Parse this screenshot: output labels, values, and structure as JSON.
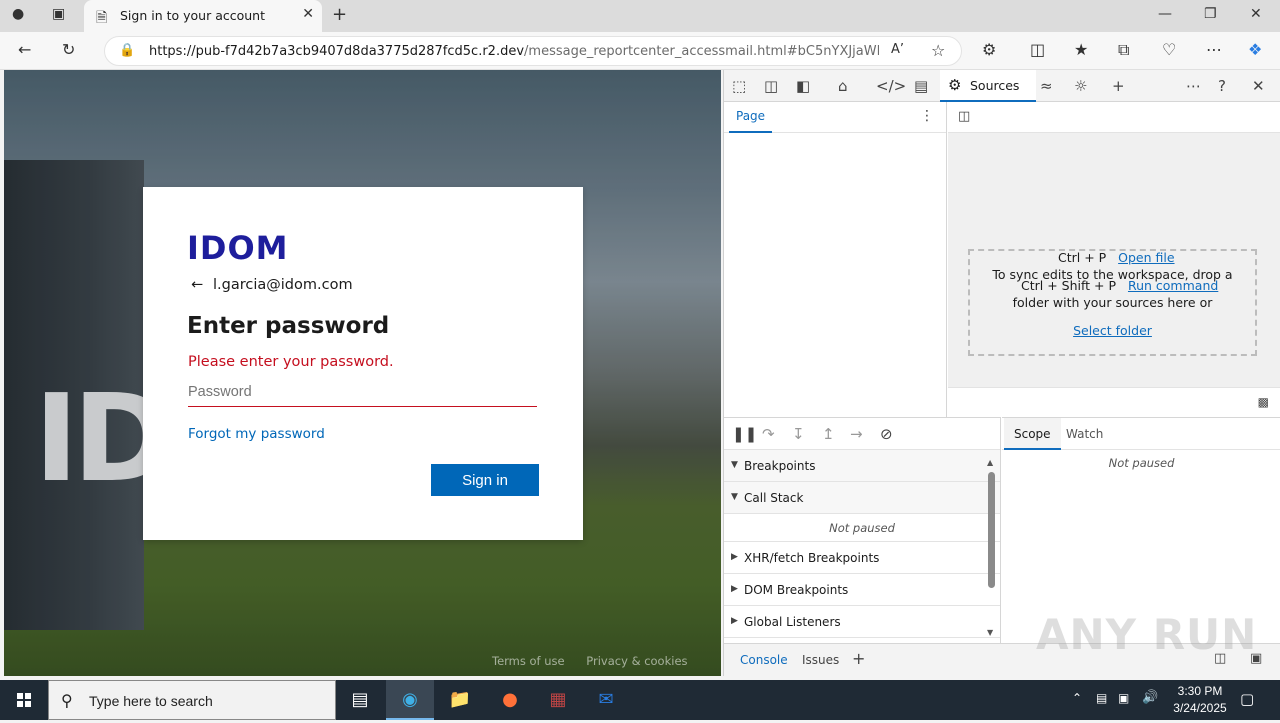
{
  "browser": {
    "tab_title": "Sign in to your account",
    "url_host": "https://pub-f7d42b7a3cb9407d8da3775d287fcd5c.r2.dev",
    "url_path": "/message_reportcenter_accessmail.html#bC5nYXJjaWFAaW..."
  },
  "login": {
    "logo": "IDOM",
    "account": "l.garcia@idom.com",
    "heading": "Enter password",
    "error": "Please enter your password.",
    "password_placeholder": "Password",
    "forgot": "Forgot my password",
    "signin": "Sign in",
    "footer": [
      "Terms of use",
      "Privacy & cookies",
      "..."
    ]
  },
  "devtools": {
    "active_tab": "Sources",
    "nav_tab": "Page",
    "shortcuts": [
      {
        "keys": "Ctrl + P",
        "action": "Open file"
      },
      {
        "keys": "Ctrl + Shift + P",
        "action": "Run command"
      }
    ],
    "dropzone_text": "To sync edits to the workspace, drop a folder with your sources here or",
    "dropzone_link": "Select folder",
    "sections": {
      "breakpoints": "Breakpoints",
      "call_stack": "Call Stack",
      "not_paused": "Not paused",
      "xhr": "XHR/fetch Breakpoints",
      "dom": "DOM Breakpoints",
      "global": "Global Listeners"
    },
    "scope_tab": "Scope",
    "watch_tab": "Watch",
    "scope_not_paused": "Not paused",
    "drawer": {
      "console": "Console",
      "issues": "Issues"
    }
  },
  "watermark": "ANY RUN",
  "taskbar": {
    "search_placeholder": "Type here to search",
    "time": "3:30 PM",
    "date": "3/24/2025"
  }
}
